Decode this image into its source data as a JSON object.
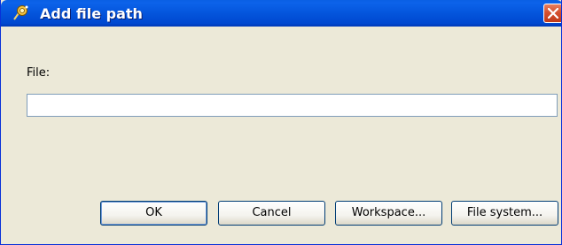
{
  "window": {
    "title": "Add file path",
    "title_icon": "dialog-app-icon",
    "close_icon": "close-icon"
  },
  "form": {
    "file_label": "File:",
    "file_value": ""
  },
  "buttons": {
    "ok": "OK",
    "cancel": "Cancel",
    "workspace": "Workspace...",
    "file_system": "File system..."
  },
  "colors": {
    "titlebar": "#0455dc",
    "dialog_bg": "#ece9d8",
    "close_button": "#d5512f",
    "input_border": "#7f9db9"
  }
}
